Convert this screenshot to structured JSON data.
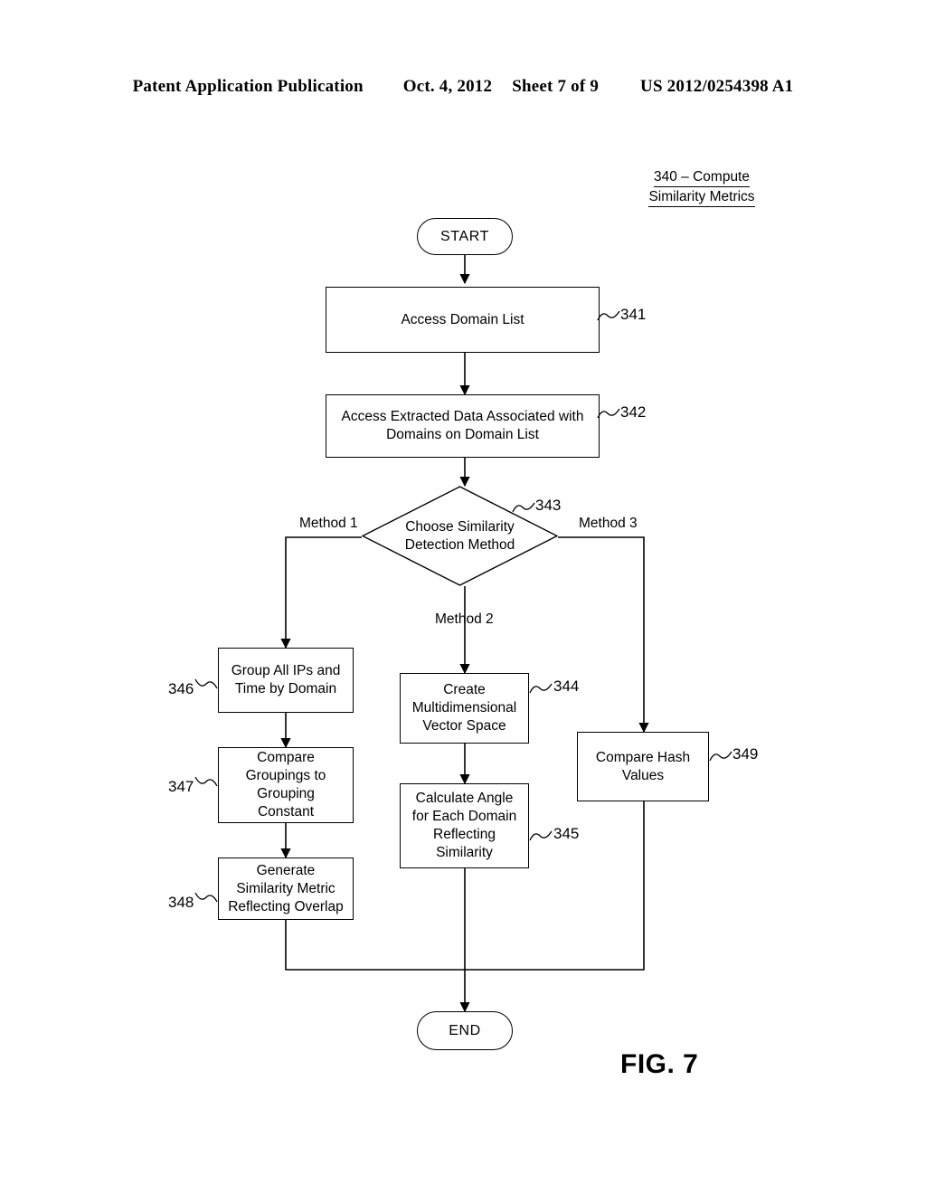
{
  "header": {
    "publication": "Patent Application Publication",
    "date": "Oct. 4, 2012",
    "sheet": "Sheet 7 of 9",
    "number": "US 2012/0254398 A1"
  },
  "figure": {
    "title_line1": "340 – Compute",
    "title_line2": "Similarity Metrics",
    "caption": "FIG. 7"
  },
  "flowchart": {
    "type": "flowchart",
    "start": {
      "label": "START"
    },
    "end": {
      "label": "END"
    },
    "nodes": [
      {
        "id": "341",
        "shape": "process",
        "label": "Access Domain List"
      },
      {
        "id": "342",
        "shape": "process",
        "label_line1": "Access Extracted Data Associated with",
        "label_line2": "Domains on Domain List"
      },
      {
        "id": "343",
        "shape": "decision",
        "label_line1": "Choose Similarity",
        "label_line2": "Detection Method"
      },
      {
        "id": "346",
        "shape": "process",
        "label_line1": "Group All IPs and",
        "label_line2": "Time by Domain"
      },
      {
        "id": "347",
        "shape": "process",
        "label_line1": "Compare",
        "label_line2": "Groupings to",
        "label_line3": "Grouping",
        "label_line4": "Constant"
      },
      {
        "id": "348",
        "shape": "process",
        "label_line1": "Generate",
        "label_line2": "Similarity Metric",
        "label_line3": "Reflecting Overlap"
      },
      {
        "id": "344",
        "shape": "process",
        "label_line1": "Create",
        "label_line2": "Multidimensional",
        "label_line3": "Vector Space"
      },
      {
        "id": "345",
        "shape": "process",
        "label_line1": "Calculate Angle",
        "label_line2": "for Each Domain",
        "label_line3": "Reflecting",
        "label_line4": "Similarity"
      },
      {
        "id": "349",
        "shape": "process",
        "label_line1": "Compare Hash",
        "label_line2": "Values"
      }
    ],
    "branch_labels": {
      "method1": "Method 1",
      "method2": "Method 2",
      "method3": "Method 3"
    },
    "ref_numbers": {
      "n341": "341",
      "n342": "342",
      "n343": "343",
      "n344": "344",
      "n345": "345",
      "n346": "346",
      "n347": "347",
      "n348": "348",
      "n349": "349"
    }
  }
}
